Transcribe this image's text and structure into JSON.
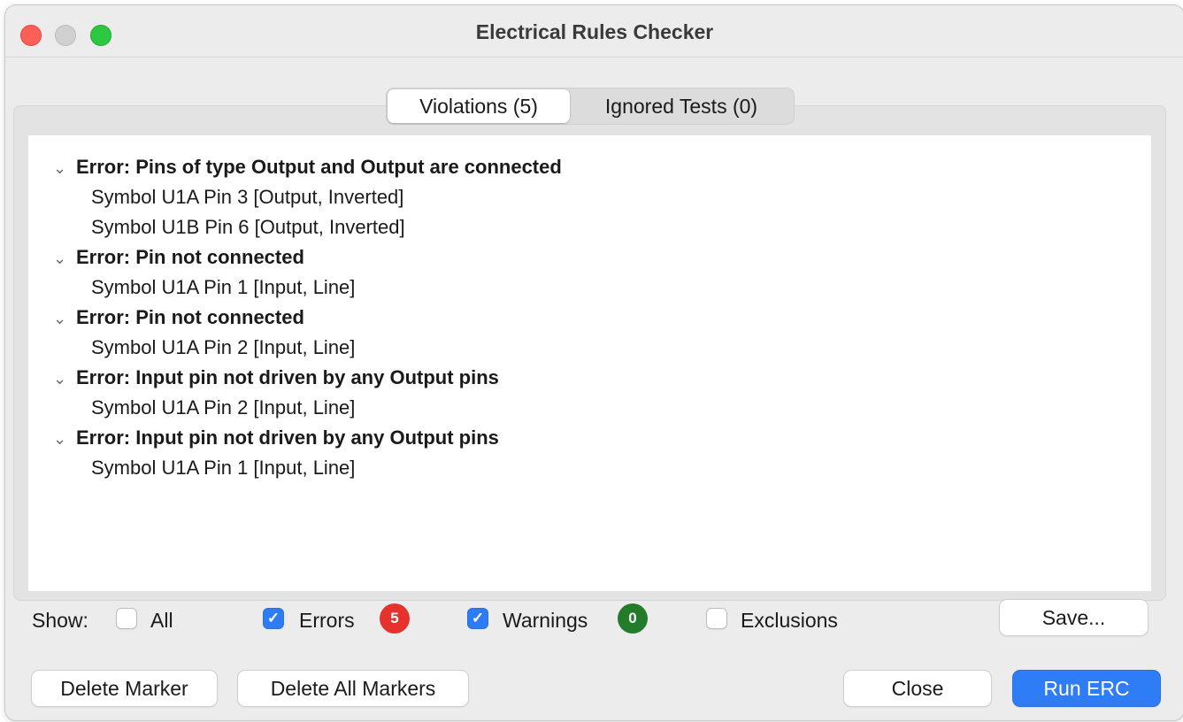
{
  "window": {
    "title": "Electrical Rules Checker"
  },
  "tabs": [
    {
      "label": "Violations (5)",
      "active": true
    },
    {
      "label": "Ignored Tests (0)",
      "active": false
    }
  ],
  "violations": [
    {
      "title": "Error: Pins of type Output and Output are connected",
      "items": [
        "Symbol U1A Pin 3 [Output, Inverted]",
        "Symbol U1B Pin 6 [Output, Inverted]"
      ]
    },
    {
      "title": "Error: Pin not connected",
      "items": [
        "Symbol U1A Pin 1 [Input, Line]"
      ]
    },
    {
      "title": "Error: Pin not connected",
      "items": [
        "Symbol U1A Pin 2 [Input, Line]"
      ]
    },
    {
      "title": "Error: Input pin not driven by any Output pins",
      "items": [
        "Symbol U1A Pin 2 [Input, Line]"
      ]
    },
    {
      "title": "Error: Input pin not driven by any Output pins",
      "items": [
        "Symbol U1A Pin 1 [Input, Line]"
      ]
    }
  ],
  "filters": {
    "show_label": "Show:",
    "all": {
      "label": "All",
      "checked": false
    },
    "errors": {
      "label": "Errors",
      "checked": true,
      "count": "5",
      "badge_color": "#e5322d"
    },
    "warnings": {
      "label": "Warnings",
      "checked": true,
      "count": "0",
      "badge_color": "#227c29"
    },
    "exclusions": {
      "label": "Exclusions",
      "checked": false
    }
  },
  "buttons": {
    "save": "Save...",
    "delete_marker": "Delete Marker",
    "delete_all_markers": "Delete All Markers",
    "close": "Close",
    "run_erc": "Run ERC"
  },
  "colors": {
    "accent": "#2f7df6",
    "checkbox_checked": "#2d7cf6"
  },
  "icons": {
    "expand": "chevron-down-icon",
    "check": "checkmark-icon"
  }
}
